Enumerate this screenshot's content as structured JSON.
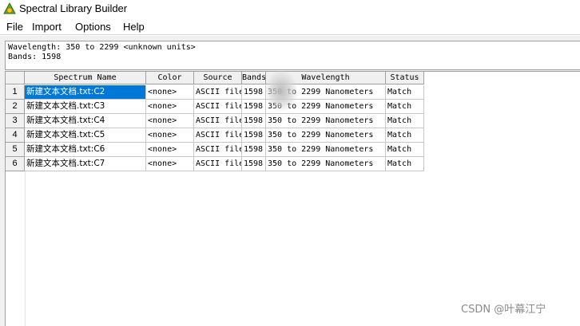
{
  "window": {
    "title": "Spectral Library Builder",
    "icon": "spectral-library-app-icon"
  },
  "menu": [
    "File",
    "Import",
    "Options",
    "Help"
  ],
  "info": {
    "wavelength": "Wavelength: 350 to 2299 <unknown units>",
    "bands": "Bands: 1598"
  },
  "table": {
    "headers": [
      "Spectrum Name",
      "Color",
      "Source",
      "Bands",
      "Wavelength",
      "Status"
    ],
    "rows": [
      {
        "num": "1",
        "name": "新建文本文档.txt:C2",
        "color": "<none>",
        "source": "ASCII file",
        "bands": "1598",
        "wavelength": "350 to 2299 Nanometers",
        "status": "Match"
      },
      {
        "num": "2",
        "name": "新建文本文档.txt:C3",
        "color": "<none>",
        "source": "ASCII file",
        "bands": "1598",
        "wavelength": "350 to 2299 Nanometers",
        "status": "Match"
      },
      {
        "num": "3",
        "name": "新建文本文档.txt:C4",
        "color": "<none>",
        "source": "ASCII file",
        "bands": "1598",
        "wavelength": "350 to 2299 Nanometers",
        "status": "Match"
      },
      {
        "num": "4",
        "name": "新建文本文档.txt:C5",
        "color": "<none>",
        "source": "ASCII file",
        "bands": "1598",
        "wavelength": "350 to 2299 Nanometers",
        "status": "Match"
      },
      {
        "num": "5",
        "name": "新建文本文档.txt:C6",
        "color": "<none>",
        "source": "ASCII file",
        "bands": "1598",
        "wavelength": "350 to 2299 Nanometers",
        "status": "Match"
      },
      {
        "num": "6",
        "name": "新建文本文档.txt:C7",
        "color": "<none>",
        "source": "ASCII file",
        "bands": "1598",
        "wavelength": "350 to 2299 Nanometers",
        "status": "Match"
      }
    ]
  },
  "watermark": "CSDN @叶幕江宁",
  "colors": {
    "selection": "#0078d7",
    "header_bg": "#f0f0f0",
    "grid_line": "#c8c8c8"
  }
}
